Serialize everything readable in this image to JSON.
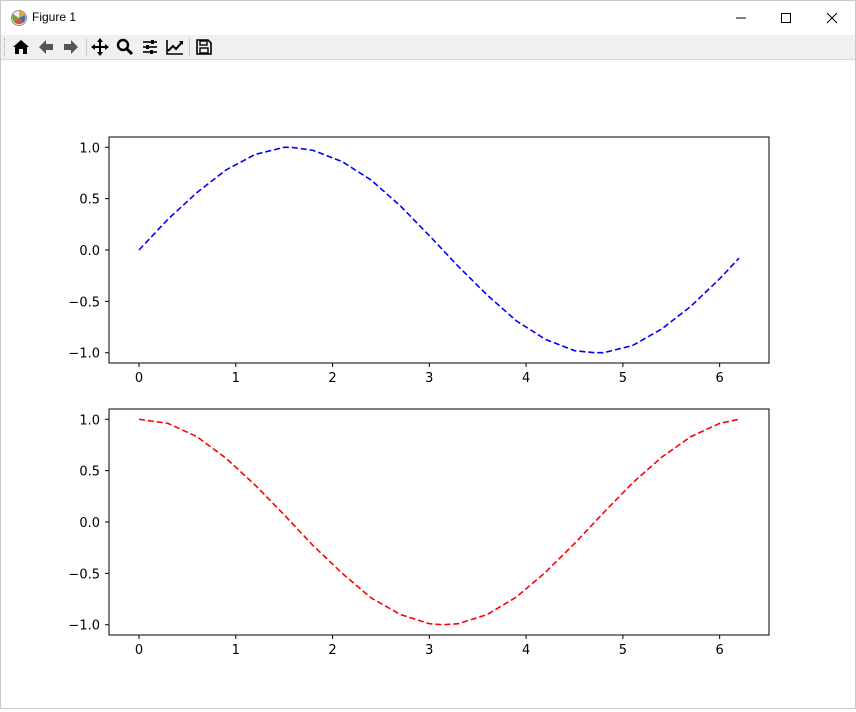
{
  "window": {
    "title": "Figure 1",
    "controls": [
      "minimize",
      "maximize",
      "close"
    ]
  },
  "toolbar": {
    "buttons": [
      {
        "name": "home",
        "icon": "home-icon"
      },
      {
        "name": "back",
        "icon": "arrow-left-icon"
      },
      {
        "name": "forward",
        "icon": "arrow-right-icon"
      },
      {
        "name": "pan",
        "icon": "move-icon"
      },
      {
        "name": "zoom",
        "icon": "magnifier-icon"
      },
      {
        "name": "configure-subplots",
        "icon": "sliders-icon"
      },
      {
        "name": "edit-axes",
        "icon": "line-chart-icon"
      },
      {
        "name": "save",
        "icon": "floppy-disk-icon"
      }
    ]
  },
  "chart_data": [
    {
      "type": "line",
      "title": "",
      "xlabel": "",
      "ylabel": "",
      "xlim": [
        -0.31,
        6.51
      ],
      "ylim": [
        -1.1,
        1.1
      ],
      "xticks": [
        "0",
        "1",
        "2",
        "3",
        "4",
        "5",
        "6"
      ],
      "yticks": [
        "1.0",
        "0.5",
        "0.0",
        "−0.5",
        "−1.0"
      ],
      "grid": false,
      "series": [
        {
          "color": "#0000ff",
          "linestyle": "dashed",
          "x": [
            0.0,
            0.3,
            0.6,
            0.9,
            1.2,
            1.5,
            1.57,
            1.8,
            2.1,
            2.4,
            2.7,
            3.0,
            3.3,
            3.6,
            3.9,
            4.2,
            4.5,
            4.71,
            4.8,
            5.1,
            5.4,
            5.7,
            6.0,
            6.2
          ],
          "y": [
            0.0,
            0.3,
            0.56,
            0.78,
            0.93,
            1.0,
            1.0,
            0.97,
            0.86,
            0.68,
            0.43,
            0.14,
            -0.16,
            -0.44,
            -0.69,
            -0.87,
            -0.98,
            -1.0,
            -1.0,
            -0.93,
            -0.77,
            -0.55,
            -0.28,
            -0.08
          ]
        }
      ]
    },
    {
      "type": "line",
      "title": "",
      "xlabel": "",
      "ylabel": "",
      "xlim": [
        -0.31,
        6.51
      ],
      "ylim": [
        -1.1,
        1.1
      ],
      "xticks": [
        "0",
        "1",
        "2",
        "3",
        "4",
        "5",
        "6"
      ],
      "yticks": [
        "1.0",
        "0.5",
        "0.0",
        "−0.5",
        "−1.0"
      ],
      "grid": false,
      "series": [
        {
          "color": "#ff0000",
          "linestyle": "dashed",
          "x": [
            0.0,
            0.3,
            0.6,
            0.9,
            1.2,
            1.5,
            1.8,
            2.1,
            2.4,
            2.7,
            3.0,
            3.14,
            3.3,
            3.6,
            3.9,
            4.2,
            4.5,
            4.8,
            5.1,
            5.4,
            5.7,
            6.0,
            6.2
          ],
          "y": [
            1.0,
            0.96,
            0.83,
            0.62,
            0.36,
            0.07,
            -0.23,
            -0.5,
            -0.74,
            -0.9,
            -0.99,
            -1.0,
            -0.99,
            -0.9,
            -0.73,
            -0.49,
            -0.21,
            0.09,
            0.38,
            0.63,
            0.83,
            0.96,
            1.0
          ]
        }
      ]
    }
  ]
}
